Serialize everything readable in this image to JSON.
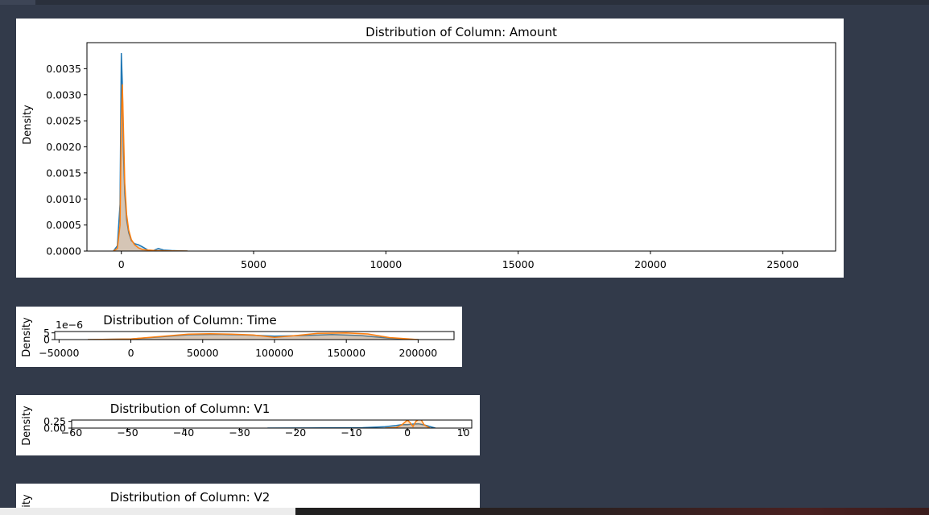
{
  "colors": {
    "background": "#323a4a",
    "series_1": "#1f77b4",
    "series_2": "#ff7f0e",
    "panel": "#ffffff"
  },
  "chart_data": [
    {
      "type": "area",
      "title": "Distribution of Column: Amount",
      "xlabel": "",
      "ylabel": "Density",
      "xlim": [
        -1300,
        27000
      ],
      "ylim": [
        0,
        0.004
      ],
      "xticks": [
        0,
        5000,
        10000,
        15000,
        20000,
        25000
      ],
      "xtick_labels": [
        "0",
        "5000",
        "10000",
        "15000",
        "20000",
        "25000"
      ],
      "yticks": [
        0,
        0.0005,
        0.001,
        0.0015,
        0.002,
        0.0025,
        0.003,
        0.0035
      ],
      "ytick_labels": [
        "0.0000",
        "0.0005",
        "0.0010",
        "0.0015",
        "0.0020",
        "0.0025",
        "0.0030",
        "0.0035"
      ],
      "grid": false,
      "series": [
        {
          "x": [
            -300,
            -150,
            -50,
            0,
            40,
            80,
            130,
            200,
            280,
            380,
            500,
            650,
            800,
            1000,
            1200,
            1400,
            1600,
            1900,
            2200,
            2500
          ],
          "values": [
            0,
            0.0001,
            0.0009,
            0.0038,
            0.0032,
            0.0019,
            0.0011,
            0.0006,
            0.00035,
            0.0002,
            0.00014,
            0.00012,
            8e-05,
            2e-05,
            1e-05,
            5e-05,
            2e-05,
            1e-05,
            3e-06,
            0
          ]
        },
        {
          "x": [
            -300,
            -150,
            -50,
            0,
            40,
            80,
            130,
            200,
            280,
            380,
            500,
            650,
            800,
            1000,
            1300,
            1700,
            2100,
            2500
          ],
          "values": [
            0,
            5e-05,
            0.0005,
            0.0025,
            0.0032,
            0.0024,
            0.0013,
            0.0007,
            0.0004,
            0.00022,
            0.00012,
            6e-05,
            3e-05,
            2e-05,
            1e-05,
            5e-06,
            2e-06,
            0
          ]
        }
      ]
    },
    {
      "type": "area",
      "title": "Distribution of Column: Time",
      "xlabel": "",
      "ylabel": "Density",
      "y_offset_label": "1e−6",
      "xlim": [
        -53000,
        225000
      ],
      "ylim": [
        0,
        6e-06
      ],
      "xticks": [
        -50000,
        0,
        50000,
        100000,
        150000,
        200000
      ],
      "xtick_labels": [
        "−50000",
        "0",
        "50000",
        "100000",
        "150000",
        "200000"
      ],
      "yticks": [
        0,
        5e-06
      ],
      "ytick_labels": [
        "0",
        "5"
      ],
      "grid": false,
      "series": [
        {
          "x": [
            -30000,
            0,
            20000,
            40000,
            60000,
            80000,
            100000,
            120000,
            140000,
            160000,
            180000,
            200000
          ],
          "values": [
            0,
            4e-07,
            2e-06,
            3.6e-06,
            3.9e-06,
            3.4e-06,
            2.6e-06,
            3e-06,
            3.7e-06,
            3e-06,
            1e-06,
            0
          ]
        },
        {
          "x": [
            -30000,
            0,
            20000,
            40000,
            55000,
            70000,
            85000,
            100000,
            115000,
            130000,
            150000,
            165000,
            180000,
            200000
          ],
          "values": [
            0,
            5e-07,
            2.2e-06,
            4e-06,
            4.3e-06,
            4e-06,
            3.5e-06,
            1.6e-06,
            3e-06,
            4.6e-06,
            5e-06,
            4.2e-06,
            1.5e-06,
            0
          ]
        }
      ]
    },
    {
      "type": "area",
      "title": "Distribution of Column: V1",
      "xlabel": "",
      "ylabel": "Density",
      "xlim": [
        -60,
        11.5
      ],
      "ylim": [
        0,
        0.3
      ],
      "xticks": [
        -60,
        -50,
        -40,
        -30,
        -20,
        -10,
        0,
        10
      ],
      "xtick_labels": [
        "−60",
        "−50",
        "−40",
        "−30",
        "−20",
        "−10",
        "0",
        "10"
      ],
      "yticks": [
        0,
        0.25
      ],
      "ytick_labels": [
        "0.00",
        "0.25"
      ],
      "grid": false,
      "series": [
        {
          "x": [
            -25,
            -15,
            -8,
            -4,
            -2,
            -1,
            0,
            1,
            2,
            3,
            5
          ],
          "values": [
            0,
            0.005,
            0.015,
            0.05,
            0.1,
            0.13,
            0.13,
            0.15,
            0.16,
            0.12,
            0
          ]
        },
        {
          "x": [
            -4,
            -2,
            -1,
            0,
            0.5,
            1,
            1.5,
            2,
            2.5,
            3,
            4
          ],
          "values": [
            0,
            0.02,
            0.12,
            0.3,
            0.2,
            0.06,
            0.25,
            0.32,
            0.3,
            0.12,
            0
          ]
        }
      ]
    },
    {
      "type": "area",
      "title": "Distribution of Column: V2",
      "xlabel": "",
      "ylabel": "Density",
      "series": []
    }
  ]
}
